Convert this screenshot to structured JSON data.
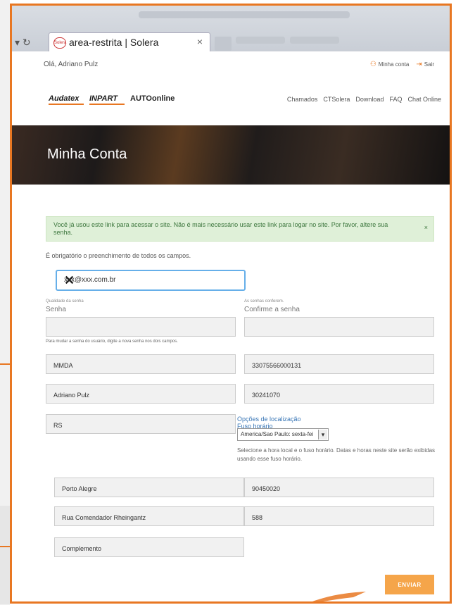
{
  "browser": {
    "tab_title": "area-restrita | Solera",
    "tab_close": "×",
    "favicon_text": "Solera"
  },
  "userbar": {
    "greeting": "Olá, Adriano Pulz",
    "account_link": "Minha conta",
    "logout_link": "Sair"
  },
  "header": {
    "logos": [
      "Audatex",
      "INPART",
      "AUTOonline"
    ],
    "nav": [
      "Chamados",
      "CTSolera",
      "Download",
      "FAQ",
      "Chat Online"
    ]
  },
  "hero": {
    "title": "Minha Conta"
  },
  "alert": {
    "message": "Você já usou este link para acessar o site. Não é mais necessário usar este link para logar no site. Por favor, altere sua senha.",
    "close": "×"
  },
  "form": {
    "required_note": "É obrigatório o preenchimento de todos os campos.",
    "email_value": "xxx@xxx.com.br",
    "password_quality_label": "Qualidade da senha",
    "password_label": "Senha",
    "password_match_label": "As senhas conferem.",
    "confirm_label": "Confirme a senha",
    "password_hint": "Para mudar a senha do usuário, digite a nova senha nos dois campos.",
    "field1": "MMDA",
    "field2": "33075566000131",
    "field3": "Adriano Pulz",
    "field4": "30241070",
    "field5": "RS",
    "localization_title": "Opções de localização",
    "timezone_label": "Fuso horário",
    "timezone_value": "America/Sao Paulo: sexta-fei",
    "timezone_help": "Selecione a hora local e o fuso horário. Datas e horas neste site serão exibidas usando esse fuso horário.",
    "city": "Porto Alegre",
    "zip": "90450020",
    "street": "Rua Comendador Rheingantz",
    "number": "588",
    "complement": "Complemento",
    "submit": "ENVIAR"
  },
  "colors": {
    "accent": "#e87722",
    "alert_bg": "#dff0d8",
    "button": "#f5a54a"
  }
}
